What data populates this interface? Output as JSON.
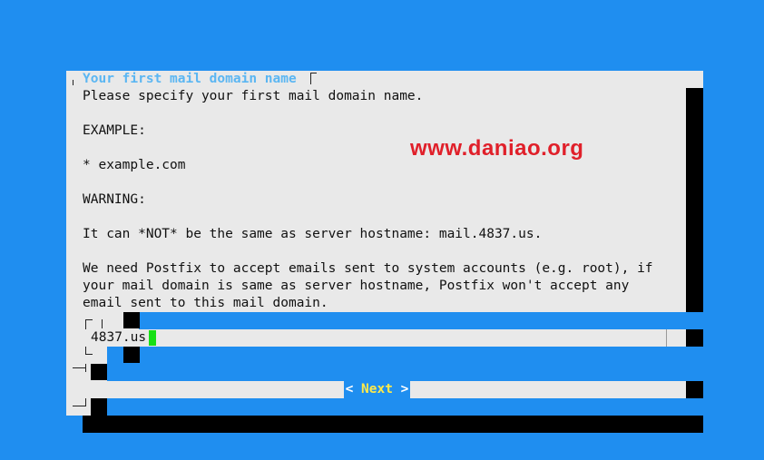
{
  "dialog": {
    "title": "Your first mail domain name",
    "body_lines": [
      "Please specify your first mail domain name.",
      "",
      "EXAMPLE:",
      "",
      "* example.com",
      "",
      "WARNING:",
      "",
      "It can *NOT* be the same as server hostname: mail.4837.us.",
      "",
      "We need Postfix to accept emails sent to system accounts (e.g. root), if",
      "your mail domain is same as server hostname, Postfix won't accept any",
      "email sent to this mail domain."
    ],
    "watermark": "www.daniao.org",
    "input": {
      "value": "4837.us"
    },
    "button": {
      "label": "Next",
      "left": "< ",
      "right": " >"
    }
  },
  "colors": {
    "background": "#1f8ef0",
    "dialog": "#e9e9e9",
    "title": "#5bb6f2",
    "button_label": "#ffe94a",
    "cursor": "#16e016",
    "watermark": "#e0202a"
  }
}
